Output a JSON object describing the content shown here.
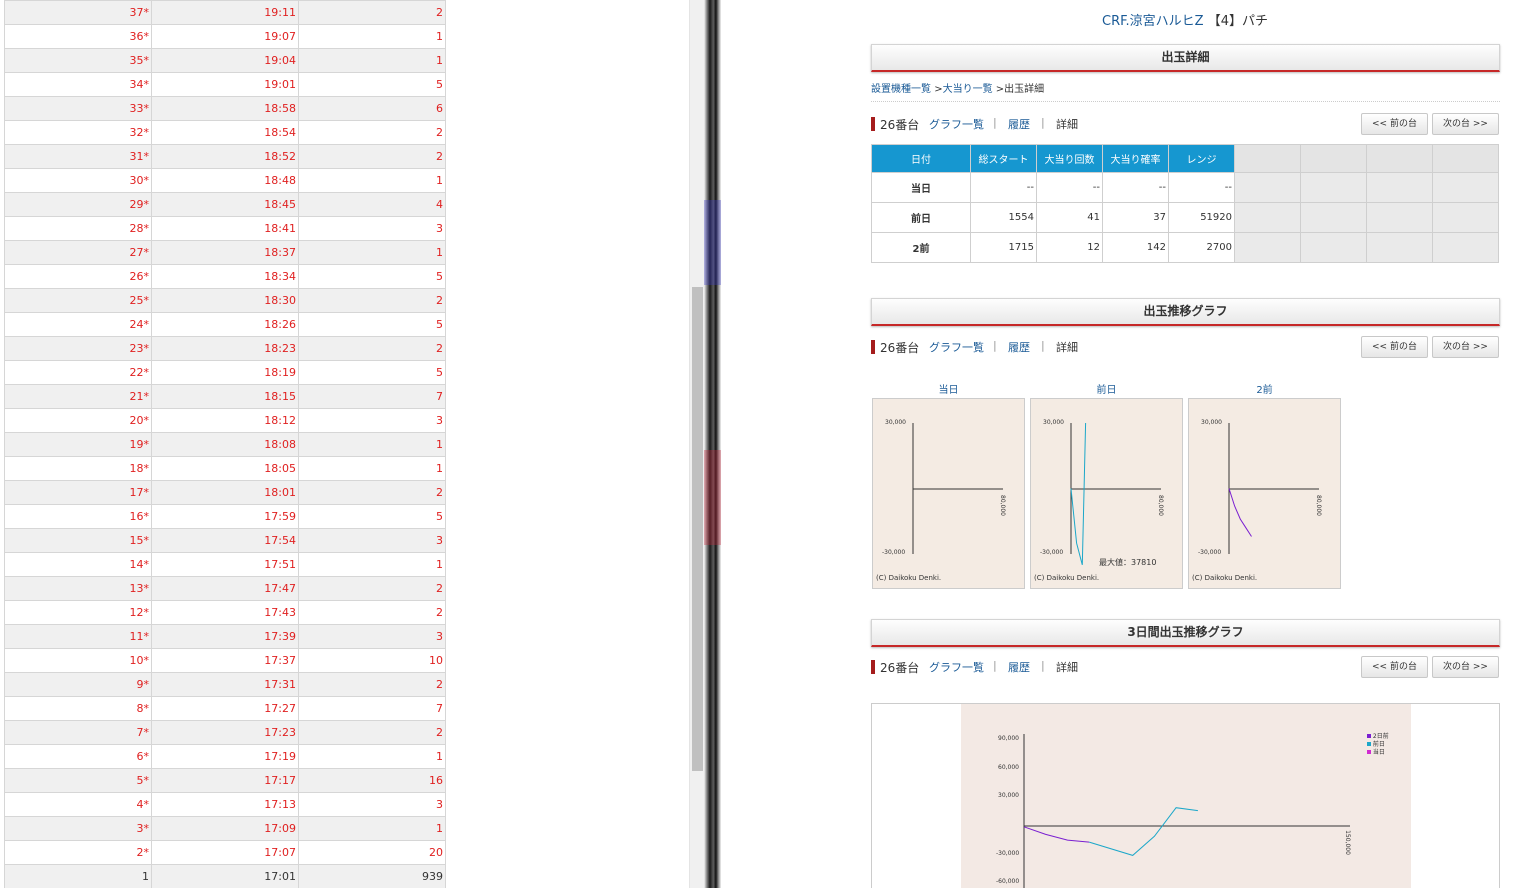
{
  "history": {
    "rows": [
      [
        "37*",
        "19:11",
        "2"
      ],
      [
        "36*",
        "19:07",
        "1"
      ],
      [
        "35*",
        "19:04",
        "1"
      ],
      [
        "34*",
        "19:01",
        "5"
      ],
      [
        "33*",
        "18:58",
        "6"
      ],
      [
        "32*",
        "18:54",
        "2"
      ],
      [
        "31*",
        "18:52",
        "2"
      ],
      [
        "30*",
        "18:48",
        "1"
      ],
      [
        "29*",
        "18:45",
        "4"
      ],
      [
        "28*",
        "18:41",
        "3"
      ],
      [
        "27*",
        "18:37",
        "1"
      ],
      [
        "26*",
        "18:34",
        "5"
      ],
      [
        "25*",
        "18:30",
        "2"
      ],
      [
        "24*",
        "18:26",
        "5"
      ],
      [
        "23*",
        "18:23",
        "2"
      ],
      [
        "22*",
        "18:19",
        "5"
      ],
      [
        "21*",
        "18:15",
        "7"
      ],
      [
        "20*",
        "18:12",
        "3"
      ],
      [
        "19*",
        "18:08",
        "1"
      ],
      [
        "18*",
        "18:05",
        "1"
      ],
      [
        "17*",
        "18:01",
        "2"
      ],
      [
        "16*",
        "17:59",
        "5"
      ],
      [
        "15*",
        "17:54",
        "3"
      ],
      [
        "14*",
        "17:51",
        "1"
      ],
      [
        "13*",
        "17:47",
        "2"
      ],
      [
        "12*",
        "17:43",
        "2"
      ],
      [
        "11*",
        "17:39",
        "3"
      ],
      [
        "10*",
        "17:37",
        "10"
      ],
      [
        "9*",
        "17:31",
        "2"
      ],
      [
        "8*",
        "17:27",
        "7"
      ],
      [
        "7*",
        "17:23",
        "2"
      ],
      [
        "6*",
        "17:19",
        "1"
      ],
      [
        "5*",
        "17:17",
        "16"
      ],
      [
        "4*",
        "17:13",
        "3"
      ],
      [
        "3*",
        "17:09",
        "1"
      ],
      [
        "2*",
        "17:07",
        "20"
      ],
      [
        "1",
        "17:01",
        "939"
      ]
    ]
  },
  "header": {
    "title": "CRF.涼宮ハルヒZ",
    "num": "【4】パチ"
  },
  "sections": {
    "detail": "出玉詳細",
    "graph": "出玉推移グラフ",
    "graph3": "3日間出玉推移グラフ"
  },
  "breadcrumb": {
    "item1": "設置機種一覧",
    "sep1": ">",
    "item2": "大当り一覧",
    "sep2": ">",
    "item3": "出玉詳細"
  },
  "nav": {
    "machine": "26番台",
    "graphs": "グラフ一覧",
    "sep": "|",
    "history": "履歴",
    "detail": "詳細",
    "prev": "<< 前の台",
    "next": "次の台 >>"
  },
  "stats": {
    "headers": [
      "日付",
      "総スタート",
      "大当り回数",
      "大当り確率",
      "レンジ"
    ],
    "rows": [
      {
        "label": "当日",
        "values": [
          "--",
          "--",
          "--",
          "--"
        ]
      },
      {
        "label": "前日",
        "values": [
          "1554",
          "41",
          "37",
          "51920"
        ]
      },
      {
        "label": "2前",
        "values": [
          "1715",
          "12",
          "142",
          "2700"
        ]
      }
    ]
  },
  "thumbs": {
    "labels": [
      "当日",
      "前日",
      "2前"
    ],
    "ytop": "30,000",
    "ybottom": "-30,000",
    "xright": "80,000",
    "copyright": "(C) Daikoku Denki.",
    "max_label": "最大値：37810"
  },
  "big": {
    "yticks": [
      "90,000",
      "60,000",
      "30,000",
      "-30,000",
      "-60,000"
    ],
    "xright": "150,000",
    "legend": [
      "2日前",
      "前日",
      "当日"
    ]
  },
  "chart_data": [
    {
      "type": "line",
      "title": "前日",
      "series": [
        {
          "values_x": [
            0,
            5000,
            10000,
            13000
          ],
          "values_y": [
            0,
            -25000,
            -35000,
            30000
          ]
        }
      ],
      "ylim": [
        -30000,
        30000
      ],
      "xlim": [
        0,
        80000
      ]
    },
    {
      "type": "line",
      "title": "2前",
      "series": [
        {
          "values_x": [
            0,
            5000,
            10000,
            15000,
            20000
          ],
          "values_y": [
            0,
            -8000,
            -14000,
            -18000,
            -22000
          ]
        }
      ],
      "ylim": [
        -30000,
        30000
      ],
      "xlim": [
        0,
        80000
      ]
    },
    {
      "type": "line",
      "series": [
        {
          "name": "2日前",
          "values_x": [
            0,
            10000,
            20000,
            30000
          ],
          "values_y": [
            0,
            -8000,
            -14000,
            -16000
          ]
        },
        {
          "name": "前日",
          "values_x": [
            30000,
            50000,
            60000,
            70000,
            80000
          ],
          "values_y": [
            -16000,
            -30000,
            -10000,
            20000,
            17000
          ]
        }
      ],
      "ylim": [
        -60000,
        90000
      ],
      "xlim": [
        0,
        150000
      ]
    }
  ]
}
